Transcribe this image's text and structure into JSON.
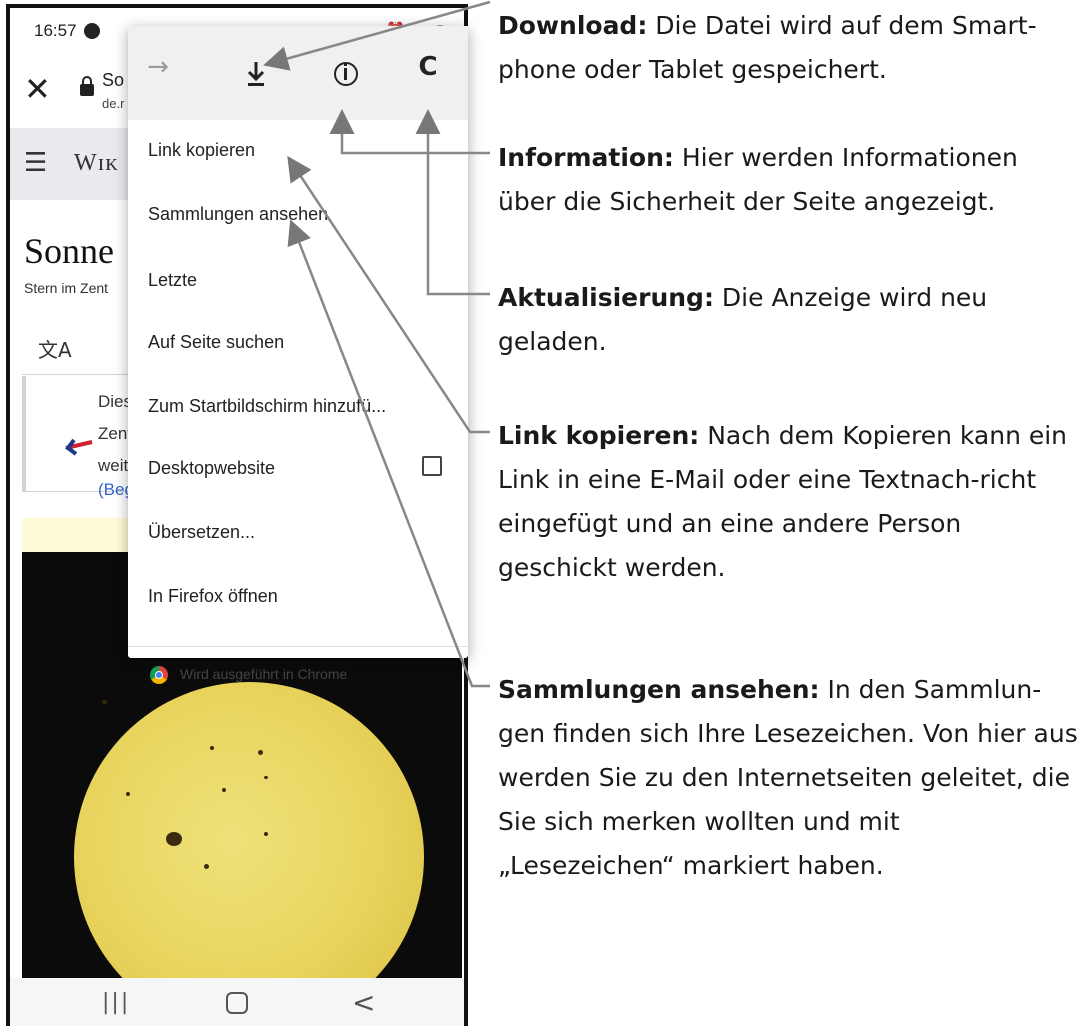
{
  "status_bar": {
    "time": "16:57",
    "icons_text": "⏰ ᯤ ▮"
  },
  "browser": {
    "url_title": "So",
    "url_host": "de.r"
  },
  "wikipedia": {
    "logo": "Wɪᴋ",
    "title": "Sonne",
    "subtitle": "Stern im Zent",
    "translate_symbol": "文A",
    "notice_lines": [
      "Diese",
      "Zent",
      "weite"
    ],
    "notice_link": "(Beg"
  },
  "menu": {
    "toolbar": {
      "forward": "→",
      "reload": "C"
    },
    "items": [
      "Link kopieren",
      "Sammlungen ansehen",
      "Letzte",
      "Auf Seite suchen",
      "Zum Startbildschirm hinzufü...",
      "Desktopwebsite",
      "Übersetzen...",
      "In Firefox öffnen"
    ],
    "desktop_checked": false,
    "footer": "Wird ausgeführt in Chrome"
  },
  "nav": {
    "recents": "|||",
    "back": "<"
  },
  "close_glyph": "✕",
  "annotations": [
    {
      "label": "Download:",
      "text": " Die Datei wird auf dem Smart-phone oder Tablet gespeichert."
    },
    {
      "label": "Information:",
      "text": " Hier werden Informationen über die Sicherheit der Seite angezeigt."
    },
    {
      "label": "Aktualisierung:",
      "text": " Die Anzeige wird neu geladen."
    },
    {
      "label": "Link kopieren:",
      "text": " Nach dem Kopieren kann ein Link in eine E-Mail oder eine Textnach-richt eingefügt und an eine andere Person geschickt werden."
    },
    {
      "label": "Sammlungen ansehen:",
      "text": " In den Sammlun-gen finden sich Ihre Lesezeichen. Von hier aus werden Sie zu den Internetseiten geleitet, die Sie sich merken wollten und mit „Lesezeichen“ markiert haben."
    }
  ]
}
